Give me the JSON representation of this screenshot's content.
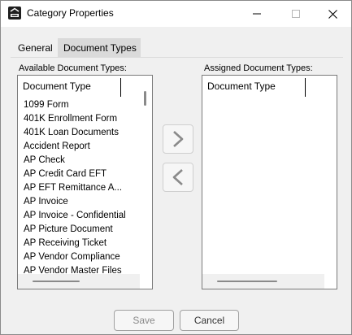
{
  "window": {
    "title": "Category Properties",
    "app_icon": "spc-logo-icon",
    "controls": [
      "minimize-icon",
      "maximize-icon",
      "close-icon"
    ]
  },
  "tabs": [
    {
      "label": "General",
      "selected": false
    },
    {
      "label": "Document Types",
      "selected": true
    }
  ],
  "available": {
    "label": "Available Document Types:",
    "column_header": "Document Type",
    "items": [
      "1099 Form",
      "401K Enrollment Form",
      "401K Loan Documents",
      "Accident Report",
      "AP Check",
      "AP Credit Card EFT",
      "AP EFT Remittance A...",
      "AP Invoice",
      "AP Invoice - Confidential",
      "AP Picture Document",
      "AP Receiving Ticket",
      "AP Vendor Compliance",
      "AP Vendor Master Files"
    ]
  },
  "assigned": {
    "label": "Assigned Document Types:",
    "column_header": "Document Type",
    "items": []
  },
  "transfer": {
    "add_icon": "chevron-right-icon",
    "remove_icon": "chevron-left-icon"
  },
  "buttons": {
    "save": "Save",
    "cancel": "Cancel",
    "save_enabled": false
  },
  "colors": {
    "window_bg": "#f0f0f0",
    "selected_tab": "#dadada",
    "disabled_text": "#8a8a8a"
  }
}
